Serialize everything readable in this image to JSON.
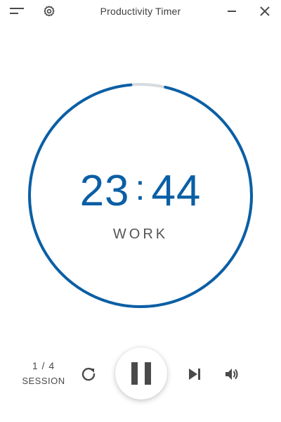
{
  "window": {
    "title": "Productivity Timer"
  },
  "titlebar": {
    "menu_icon": "menu-icon",
    "settings_icon": "gear-icon",
    "minimize_icon": "minimize-icon",
    "close_icon": "close-icon"
  },
  "timer": {
    "minutes": "23",
    "separator": ":",
    "seconds": "44",
    "mode": "WORK",
    "progress_remaining_fraction": 0.95
  },
  "session": {
    "count": "1 / 4",
    "label": "SESSION"
  },
  "controls": {
    "reset_icon": "reset-icon",
    "pause_icon": "pause-icon",
    "skip_icon": "skip-next-icon",
    "volume_icon": "volume-icon"
  },
  "colors": {
    "accent": "#0b5fa5",
    "track": "#d6dbe0",
    "icon": "#4a4a4a"
  }
}
